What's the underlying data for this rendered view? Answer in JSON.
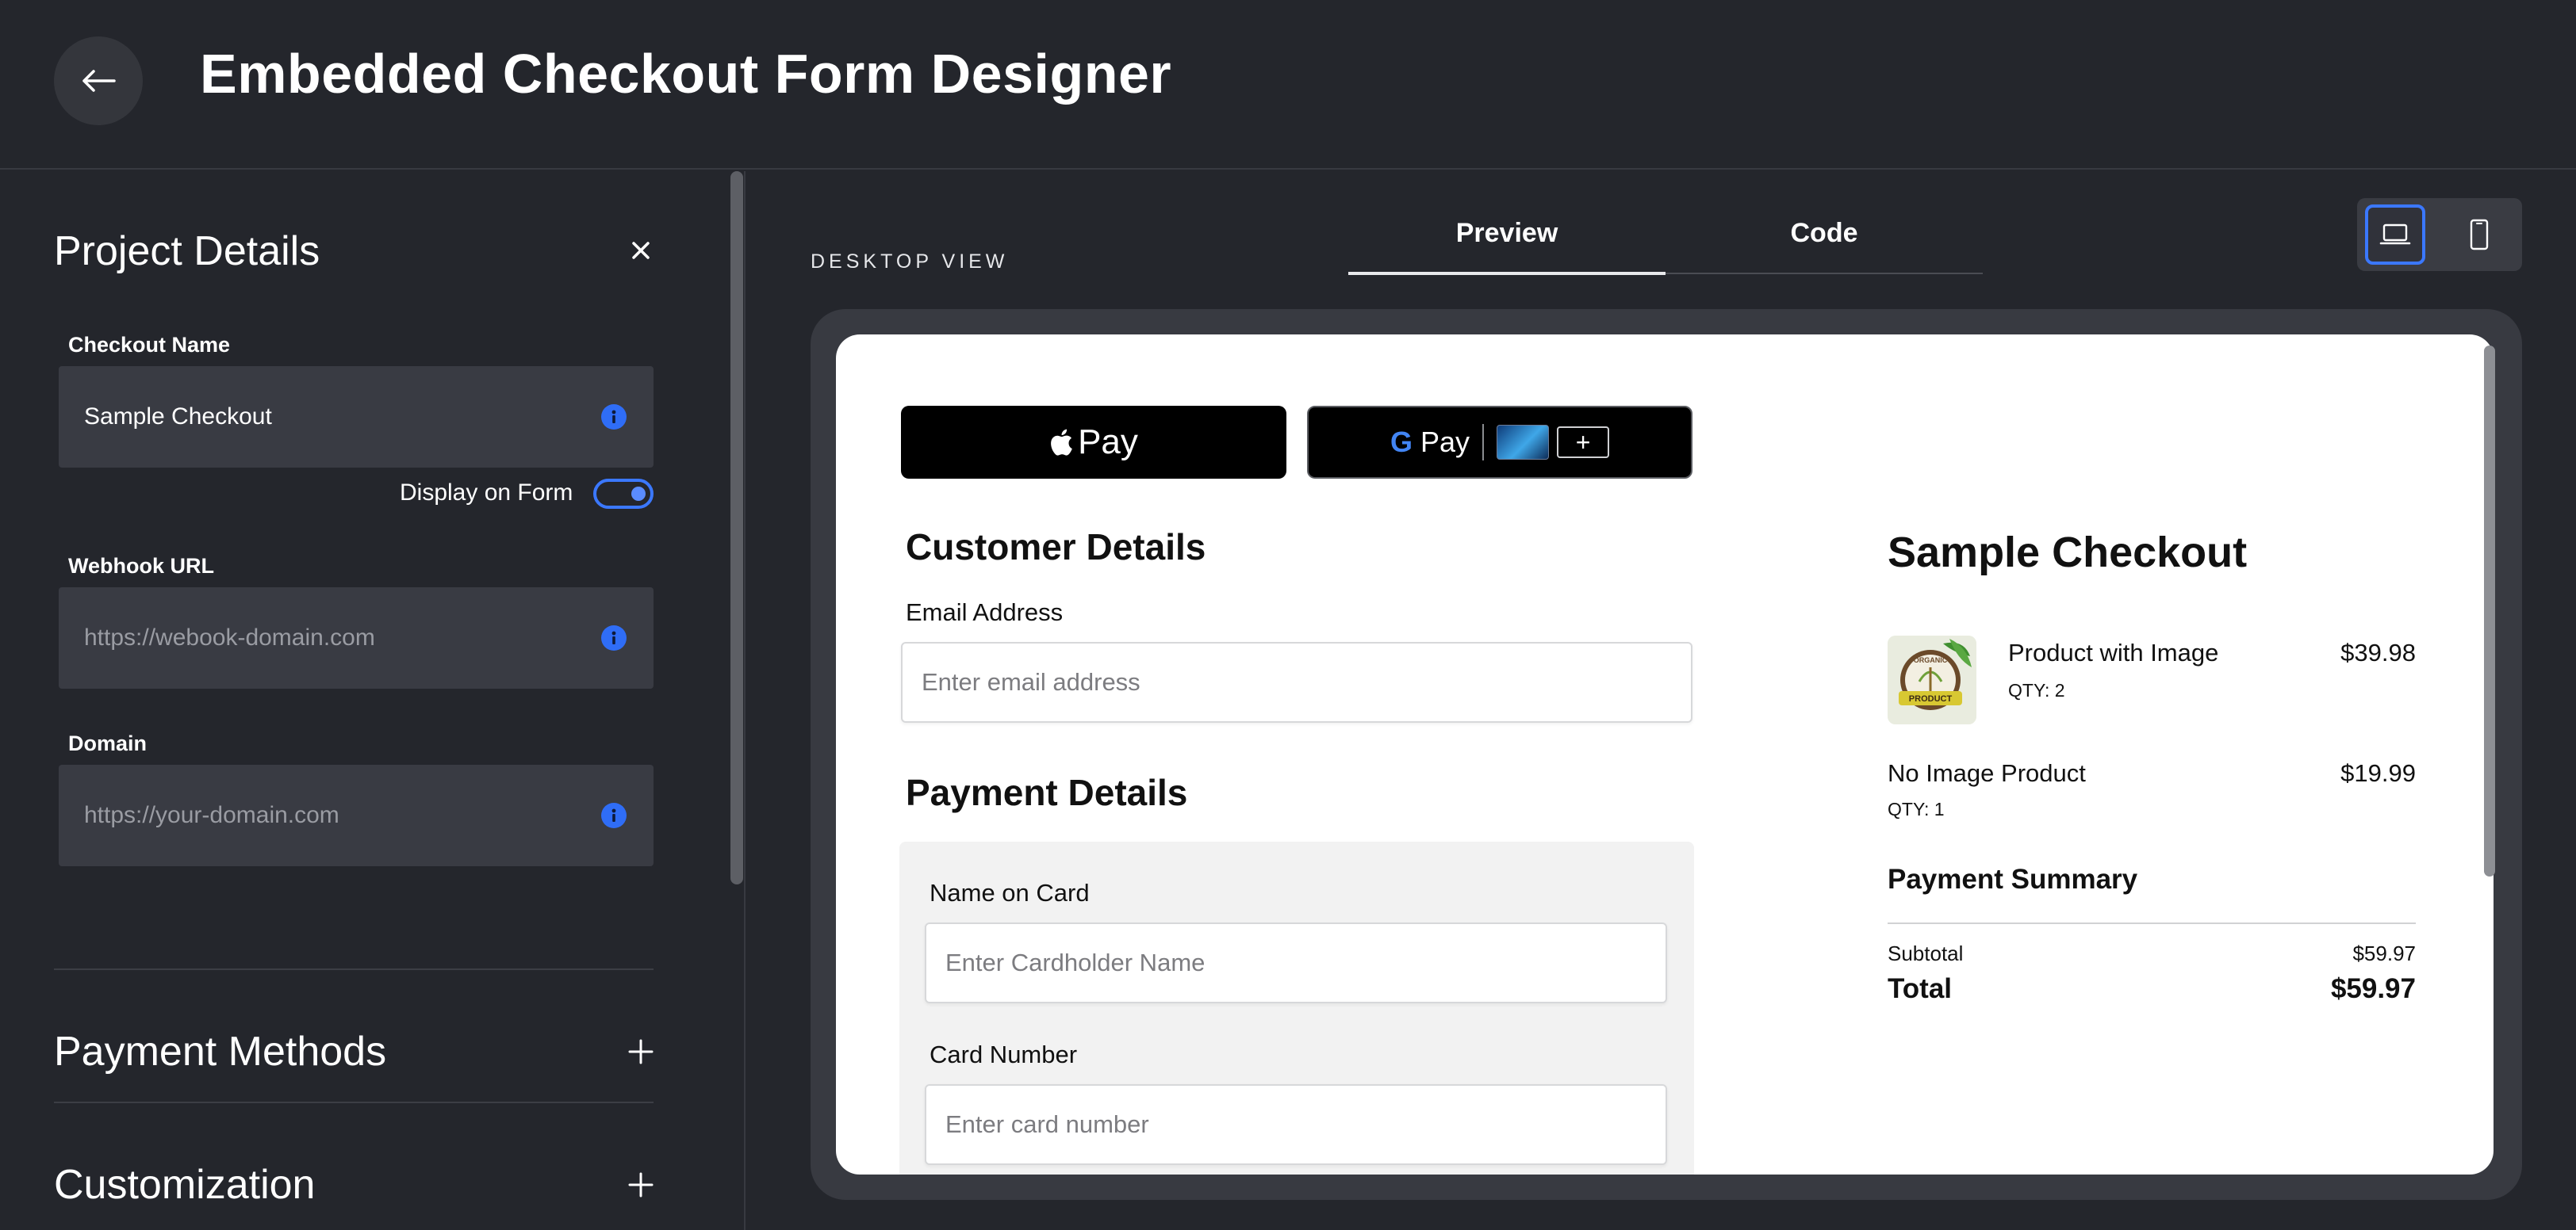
{
  "header": {
    "back_icon": "arrow-left-icon",
    "title": "Embedded Checkout Form Designer"
  },
  "sidebar": {
    "project_details": {
      "title": "Project Details",
      "close_icon": "close-icon",
      "checkout_name": {
        "label": "Checkout Name",
        "value": "Sample Checkout",
        "info_icon": "info-icon"
      },
      "display_on_form": {
        "label": "Display on Form",
        "enabled": true
      },
      "webhook_url": {
        "label": "Webhook URL",
        "placeholder": "https://webook-domain.com",
        "info_icon": "info-icon"
      },
      "domain": {
        "label": "Domain",
        "placeholder": "https://your-domain.com",
        "info_icon": "info-icon"
      }
    },
    "sections": [
      {
        "title": "Payment Methods",
        "icon": "plus-icon"
      },
      {
        "title": "Customization",
        "icon": "plus-icon"
      }
    ]
  },
  "main": {
    "view_label": "DESKTOP VIEW",
    "tabs": [
      {
        "label": "Preview",
        "active": true
      },
      {
        "label": "Code",
        "active": false
      }
    ],
    "device_switch": [
      {
        "icon": "laptop-icon",
        "active": true
      },
      {
        "icon": "mobile-icon",
        "active": false
      }
    ],
    "accent_color": "#3b78ff"
  },
  "preview": {
    "wallets": {
      "apple_pay": {
        "glyph": "",
        "label": "Pay"
      },
      "google_pay": {
        "g": "G",
        "label": "Pay",
        "add_symbol": "+"
      }
    },
    "customer_details": {
      "title": "Customer Details",
      "email_label": "Email Address",
      "email_placeholder": "Enter email address"
    },
    "payment_details": {
      "title": "Payment Details",
      "name_label": "Name on Card",
      "name_placeholder": "Enter Cardholder Name",
      "card_label": "Card Number",
      "card_placeholder": "Enter card number"
    },
    "summary": {
      "title": "Sample Checkout",
      "items": [
        {
          "name": "Product with Image",
          "qty": "QTY: 2",
          "price": "$39.98",
          "has_image": true
        },
        {
          "name": "No Image Product",
          "qty": "QTY: 1",
          "price": "$19.99",
          "has_image": false
        }
      ],
      "payment_summary_title": "Payment Summary",
      "subtotal_label": "Subtotal",
      "subtotal_value": "$59.97",
      "total_label": "Total",
      "total_value": "$59.97"
    }
  }
}
